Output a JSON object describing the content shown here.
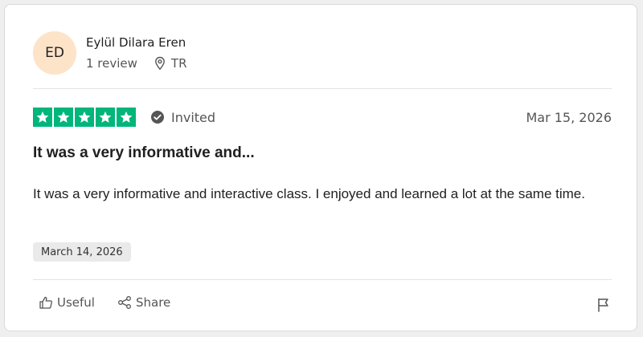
{
  "reviewer": {
    "initials": "ED",
    "name": "Eylül Dilara Eren",
    "review_count": "1 review",
    "country": "TR",
    "avatar_color": "#fde3c8"
  },
  "review": {
    "rating": 5,
    "max_rating": 5,
    "star_color": "#00b67a",
    "verification": "Invited",
    "date": "Mar 15, 2026",
    "title": "It was a very informative and...",
    "body": "It was a very informative and interactive class. I enjoyed and learned a lot at the same time.",
    "experience_date": "March 14, 2026"
  },
  "actions": {
    "useful_label": "Useful",
    "share_label": "Share"
  },
  "icons": {
    "location": "location-pin-icon",
    "verified": "check-circle-icon",
    "useful": "thumbs-up-icon",
    "share": "share-icon",
    "report": "flag-icon"
  }
}
